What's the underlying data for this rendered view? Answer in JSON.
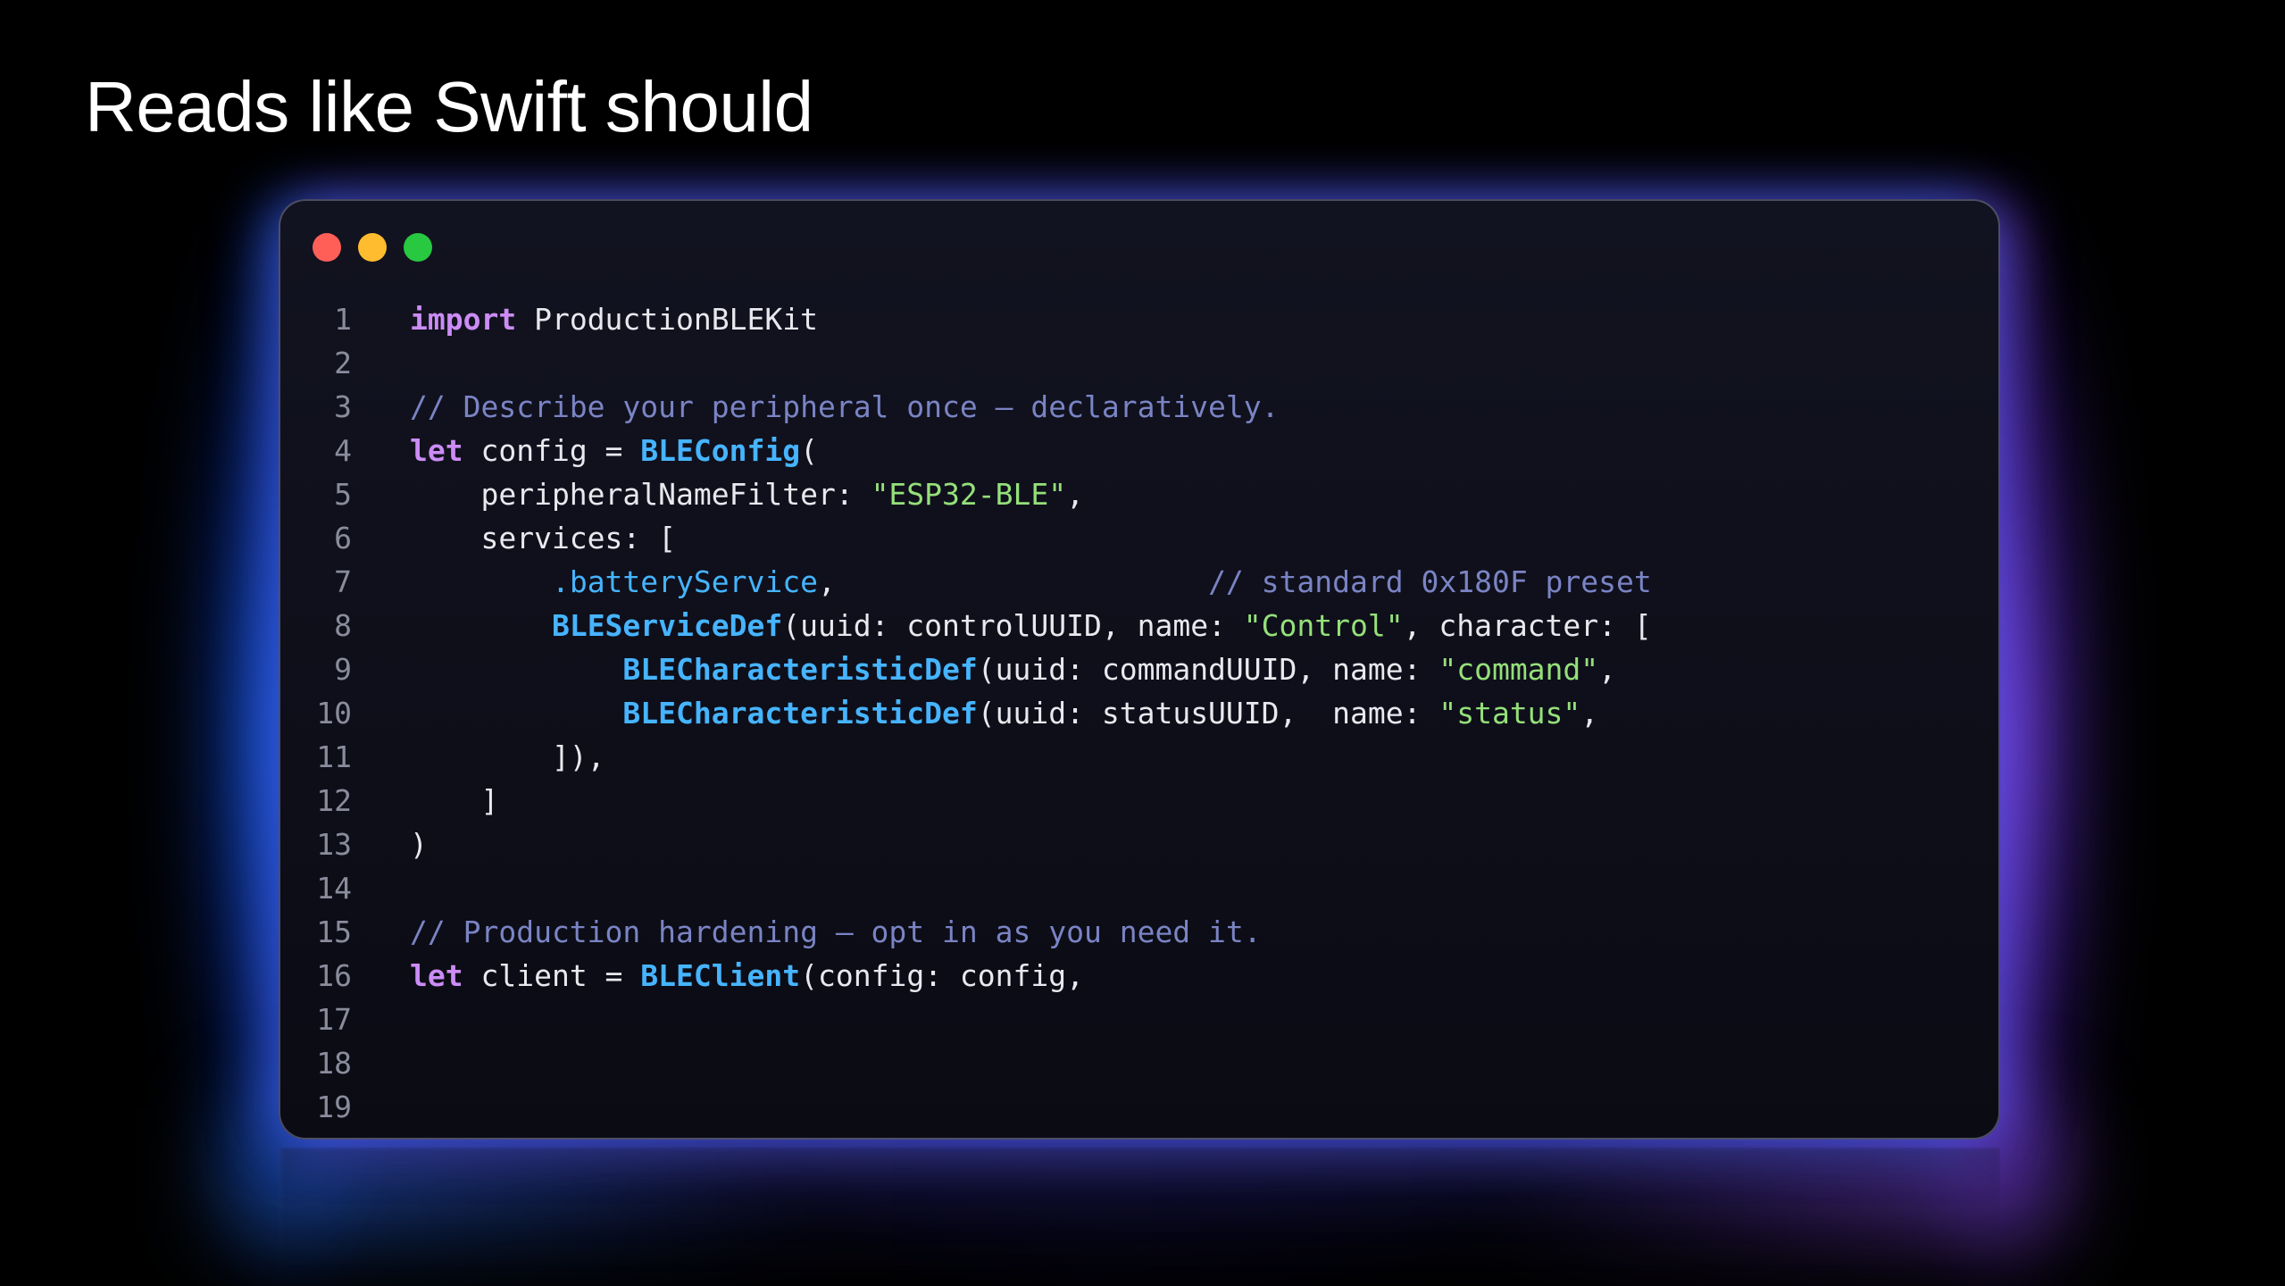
{
  "slide": {
    "title": "Reads like Swift should"
  },
  "colors": {
    "background": "#000000",
    "keyword": "#cc8cf5",
    "type": "#46b4ff",
    "string": "#95e07a",
    "comment": "#7a84c4",
    "text": "#e8e8ee",
    "line_number": "#8a8c9c",
    "traffic_red": "#ff5f57",
    "traffic_yellow": "#febc2e",
    "traffic_green": "#28c840"
  },
  "editor": {
    "lines": [
      {
        "n": "1",
        "tokens": [
          {
            "k": "kw",
            "t": "import"
          },
          {
            "k": "tx",
            "t": " ProductionBLEKit"
          }
        ]
      },
      {
        "n": "2",
        "tokens": []
      },
      {
        "n": "3",
        "tokens": [
          {
            "k": "cm",
            "t": "// Describe your peripheral once — declaratively."
          }
        ]
      },
      {
        "n": "4",
        "tokens": [
          {
            "k": "kw",
            "t": "let"
          },
          {
            "k": "tx",
            "t": " config = "
          },
          {
            "k": "ty",
            "t": "BLEConfig"
          },
          {
            "k": "tx",
            "t": "("
          }
        ]
      },
      {
        "n": "5",
        "tokens": [
          {
            "k": "tx",
            "t": "    peripheralNameFilter: "
          },
          {
            "k": "str",
            "t": "\"ESP32-BLE\""
          },
          {
            "k": "tx",
            "t": ","
          }
        ]
      },
      {
        "n": "6",
        "tokens": [
          {
            "k": "tx",
            "t": "    services: ["
          }
        ]
      },
      {
        "n": "7",
        "tokens": [
          {
            "k": "tx",
            "t": "        "
          },
          {
            "k": "mem",
            "t": ".batteryService"
          },
          {
            "k": "tx",
            "t": ",                     "
          },
          {
            "k": "cm",
            "t": "// standard 0x180F preset"
          }
        ]
      },
      {
        "n": "8",
        "tokens": [
          {
            "k": "tx",
            "t": "        "
          },
          {
            "k": "ty",
            "t": "BLEServiceDef"
          },
          {
            "k": "tx",
            "t": "(uuid: controlUUID, name: "
          },
          {
            "k": "str",
            "t": "\"Control\""
          },
          {
            "k": "tx",
            "t": ", character: ["
          }
        ]
      },
      {
        "n": "9",
        "tokens": [
          {
            "k": "tx",
            "t": "            "
          },
          {
            "k": "ty",
            "t": "BLECharacteristicDef"
          },
          {
            "k": "tx",
            "t": "(uuid: commandUUID, name: "
          },
          {
            "k": "str",
            "t": "\"command\""
          },
          {
            "k": "tx",
            "t": ","
          }
        ]
      },
      {
        "n": "10",
        "tokens": [
          {
            "k": "tx",
            "t": "            "
          },
          {
            "k": "ty",
            "t": "BLECharacteristicDef"
          },
          {
            "k": "tx",
            "t": "(uuid: statusUUID,  name: "
          },
          {
            "k": "str",
            "t": "\"status\""
          },
          {
            "k": "tx",
            "t": ","
          }
        ]
      },
      {
        "n": "11",
        "tokens": [
          {
            "k": "tx",
            "t": "        ]),"
          }
        ]
      },
      {
        "n": "12",
        "tokens": [
          {
            "k": "tx",
            "t": "    ]"
          }
        ]
      },
      {
        "n": "13",
        "tokens": [
          {
            "k": "tx",
            "t": ")"
          }
        ]
      },
      {
        "n": "14",
        "tokens": []
      },
      {
        "n": "15",
        "tokens": [
          {
            "k": "cm",
            "t": "// Production hardening — opt in as you need it."
          }
        ]
      },
      {
        "n": "16",
        "tokens": [
          {
            "k": "kw",
            "t": "let"
          },
          {
            "k": "tx",
            "t": " client = "
          },
          {
            "k": "ty",
            "t": "BLEClient"
          },
          {
            "k": "tx",
            "t": "(config: config,"
          }
        ]
      },
      {
        "n": "17",
        "tokens": []
      },
      {
        "n": "18",
        "tokens": []
      },
      {
        "n": "19",
        "tokens": []
      }
    ]
  }
}
